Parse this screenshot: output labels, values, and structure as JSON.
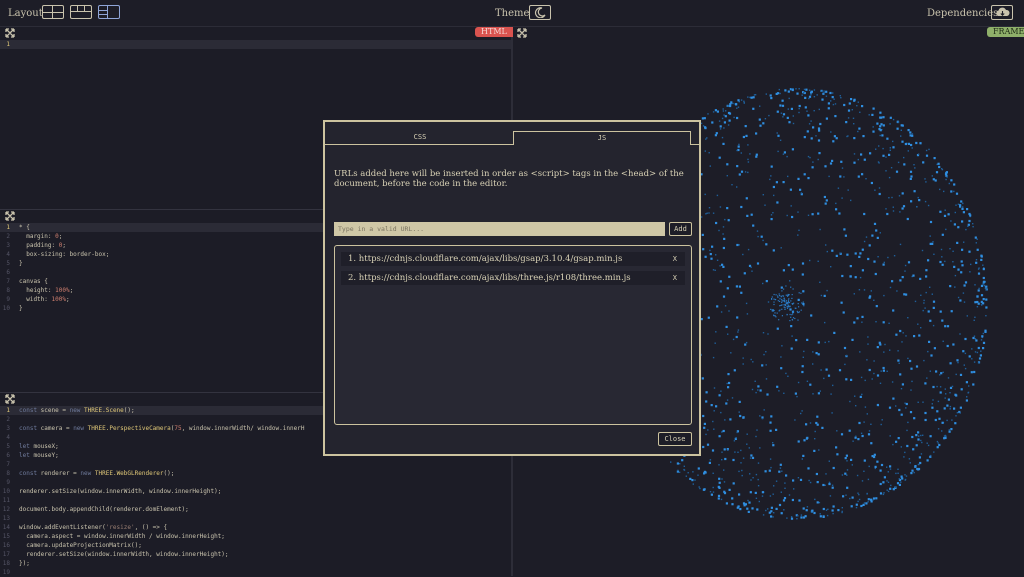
{
  "topbar": {
    "layout_label": "Layout",
    "theme_label": "Theme",
    "dependencies_label": "Dependencies"
  },
  "panes": {
    "html_tag": "HTML",
    "frame_tag": "FRAME"
  },
  "html_editor": {
    "lines": [
      "1"
    ]
  },
  "css_editor": {
    "lines": [
      {
        "n": "1",
        "t": "* {"
      },
      {
        "n": "2",
        "t": "  margin: 0;"
      },
      {
        "n": "3",
        "t": "  padding: 0;"
      },
      {
        "n": "4",
        "t": "  box-sizing: border-box;"
      },
      {
        "n": "5",
        "t": "}"
      },
      {
        "n": "6",
        "t": ""
      },
      {
        "n": "7",
        "t": "canvas {"
      },
      {
        "n": "8",
        "t": "  height: 100%;"
      },
      {
        "n": "9",
        "t": "  width: 100%;"
      },
      {
        "n": "10",
        "t": "}"
      }
    ]
  },
  "js_editor": {
    "lines": [
      {
        "n": "1",
        "t": "const scene = new THREE.Scene();"
      },
      {
        "n": "2",
        "t": ""
      },
      {
        "n": "3",
        "t": "const camera = new THREE.PerspectiveCamera(75, window.innerWidth/ window.innerH"
      },
      {
        "n": "4",
        "t": ""
      },
      {
        "n": "5",
        "t": "let mouseX;"
      },
      {
        "n": "6",
        "t": "let mouseY;"
      },
      {
        "n": "7",
        "t": ""
      },
      {
        "n": "8",
        "t": "const renderer = new THREE.WebGLRenderer();"
      },
      {
        "n": "9",
        "t": ""
      },
      {
        "n": "10",
        "t": "renderer.setSize(window.innerWidth, window.innerHeight);"
      },
      {
        "n": "11",
        "t": ""
      },
      {
        "n": "12",
        "t": "document.body.appendChild(renderer.domElement);"
      },
      {
        "n": "13",
        "t": ""
      },
      {
        "n": "14",
        "t": "window.addEventListener('resize', () => {"
      },
      {
        "n": "15",
        "t": "  camera.aspect = window.innerWidth / window.innerHeight;"
      },
      {
        "n": "16",
        "t": "  camera.updateProjectionMatrix();"
      },
      {
        "n": "17",
        "t": "  renderer.setSize(window.innerWidth, window.innerHeight);"
      },
      {
        "n": "18",
        "t": "});"
      },
      {
        "n": "19",
        "t": ""
      }
    ]
  },
  "modal": {
    "tabs": [
      {
        "label": "CSS"
      },
      {
        "label": "JS"
      }
    ],
    "info": "URLs added here will be inserted in order as <script> tags in the <head> of the document, before the code in the editor.",
    "input_placeholder": "Type in a valid URL...",
    "add_label": "Add",
    "items": [
      {
        "label": "1. https://cdnjs.cloudflare.com/ajax/libs/gsap/3.10.4/gsap.min.js",
        "remove": "X"
      },
      {
        "label": "2. https://cdnjs.cloudflare.com/ajax/libs/three.js/r108/three.min.js",
        "remove": "X"
      }
    ],
    "close_label": "Close"
  },
  "colors": {
    "background": "#1d1d27",
    "accent": "#ccc39f",
    "html_tag": "#d9534f",
    "frame_tag": "#8fb06a",
    "particles": "#2f8ee0"
  }
}
